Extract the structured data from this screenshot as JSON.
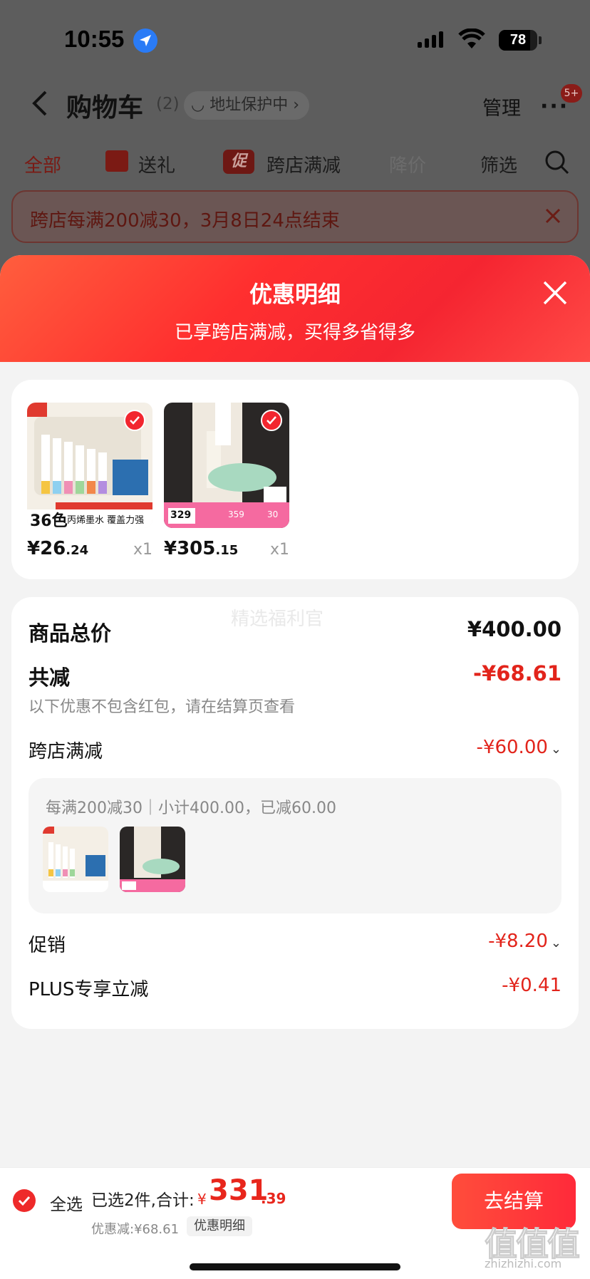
{
  "status_bar": {
    "time": "10:55",
    "battery": "78"
  },
  "header": {
    "title": "购物车",
    "count": "(2)",
    "address_protection": "地址保护中",
    "manage": "管理",
    "more_badge": "5+"
  },
  "tabs": [
    {
      "label": "全部"
    },
    {
      "label": "送礼"
    },
    {
      "label": "跨店满减",
      "icon_text": "促"
    },
    {
      "label": "降价"
    },
    {
      "label": "筛选"
    }
  ],
  "banner": {
    "text": "跨店每满200减30，3月8日24点结束"
  },
  "sheet": {
    "title": "优惠明细",
    "subtitle": "已享跨店满减，买得多省得多"
  },
  "products": [
    {
      "name": "deli marker set",
      "badge": "36色",
      "caption": "丙烯墨水 覆盖力强",
      "price_int": "¥26",
      "price_dec": ".24",
      "qty": "x1"
    },
    {
      "name": "adidas sneakers",
      "price_tags": [
        "329",
        "359",
        "30"
      ],
      "price_int": "¥305",
      "price_dec": ".15",
      "qty": "x1"
    }
  ],
  "breakdown": {
    "watermark": "精选福利官",
    "total_label": "商品总价",
    "total_value": "¥400.00",
    "discount_label": "共减",
    "discount_value": "-¥68.61",
    "discount_note": "以下优惠不包含红包，请在结算页查看",
    "cross_store_label": "跨店满减",
    "cross_store_value": "-¥60.00",
    "cross_store_detail": "每满200减30｜小计400.00，已减60.00",
    "promo_label": "促销",
    "promo_value": "-¥8.20",
    "plus_label": "PLUS专享立减",
    "plus_value": "-¥0.41"
  },
  "bottom_bar": {
    "select_all": "全选",
    "selected": "已选2件,合计:",
    "currency": "¥",
    "total_int": "331",
    "total_dec": ".39",
    "discount_text": "优惠减:¥68.61",
    "discount_detail": "优惠明细",
    "checkout": "去结算"
  },
  "watermark_site": {
    "logo": "值值值",
    "url": "zhizhizhi.com"
  },
  "colors": {
    "accent_red": "#f2262f",
    "discount_red": "#e2241b"
  }
}
